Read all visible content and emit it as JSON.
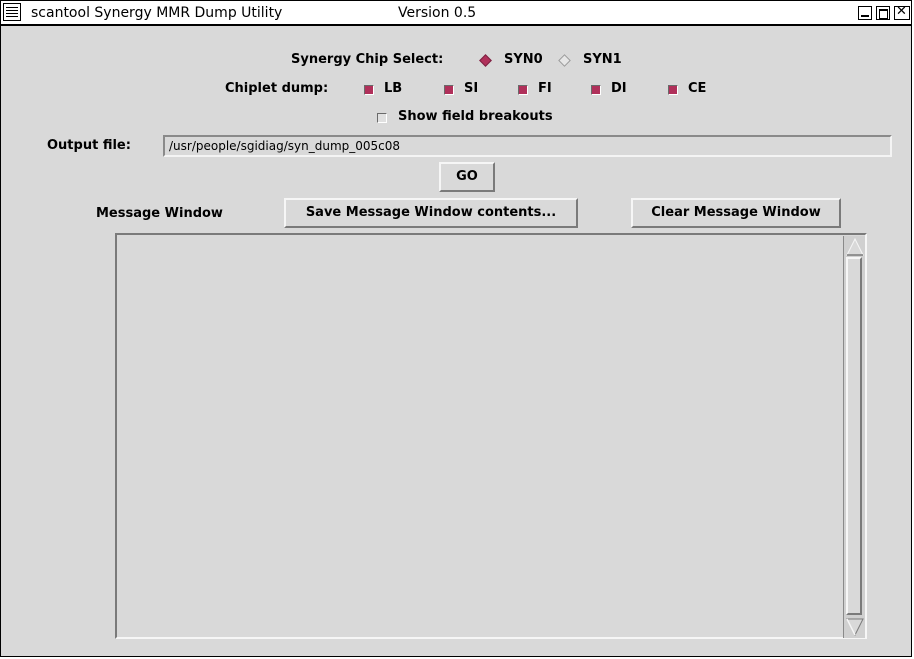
{
  "window": {
    "title": "scantool Synergy MMR Dump Utility",
    "version": "Version 0.5",
    "close_glyph": "✕"
  },
  "chip_select": {
    "label": "Synergy Chip Select:",
    "options": [
      {
        "label": "SYN0",
        "selected": true
      },
      {
        "label": "SYN1",
        "selected": false
      }
    ]
  },
  "chiplet_dump": {
    "label": "Chiplet dump:",
    "options": [
      {
        "label": "LB",
        "checked": true
      },
      {
        "label": "SI",
        "checked": true
      },
      {
        "label": "FI",
        "checked": true
      },
      {
        "label": "DI",
        "checked": true
      },
      {
        "label": "CE",
        "checked": true
      }
    ]
  },
  "field_breakouts": {
    "label": "Show field breakouts",
    "checked": false
  },
  "output_file": {
    "label": "Output file:",
    "value": "/usr/people/sgidiag/syn_dump_005c08"
  },
  "go_button": "GO",
  "message_window": {
    "label": "Message Window",
    "save_button": "Save Message Window contents...",
    "clear_button": "Clear Message Window",
    "content": ""
  },
  "colors": {
    "window_bg": "#d9d9d9",
    "selected_indicator": "#b0305a",
    "titlebar_bg": "#ffffff"
  }
}
